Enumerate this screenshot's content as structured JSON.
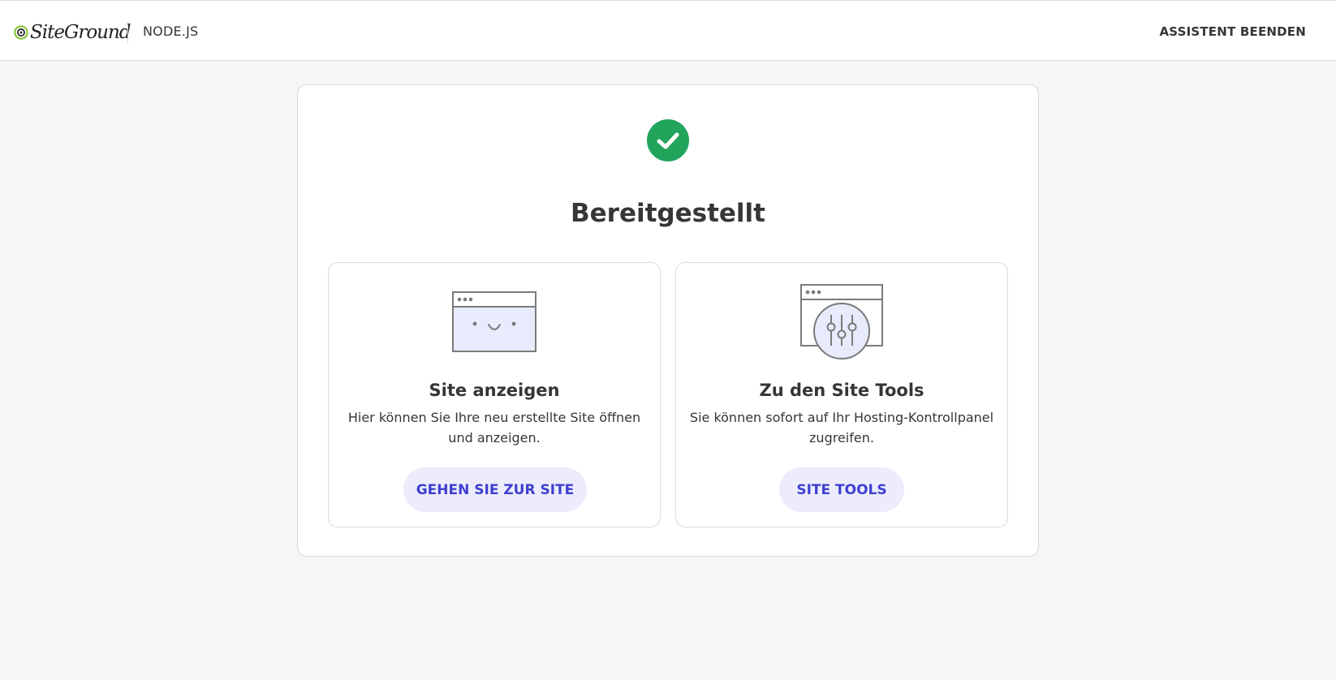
{
  "header": {
    "logo_text": "SiteGround",
    "product": "NODE.JS",
    "exit_label": "ASSISTENT BEENDEN"
  },
  "main": {
    "status_icon": "check-circle-icon",
    "title": "Bereitgestellt",
    "options": [
      {
        "icon": "browser-window-smiley-icon",
        "title": "Site anzeigen",
        "description": "Hier können Sie Ihre neu erstellte Site öffnen und anzeigen.",
        "button_label": "GEHEN SIE ZUR SITE"
      },
      {
        "icon": "browser-window-sliders-icon",
        "title": "Zu den Site Tools",
        "description": "Sie können sofort auf Ihr Hosting-Kontrollpanel zugreifen.",
        "button_label": "SITE TOOLS"
      }
    ]
  },
  "colors": {
    "success": "#22a45d",
    "button_bg": "#ececfc",
    "button_text": "#3f3fd1",
    "page_bg": "#f6f6f6"
  }
}
